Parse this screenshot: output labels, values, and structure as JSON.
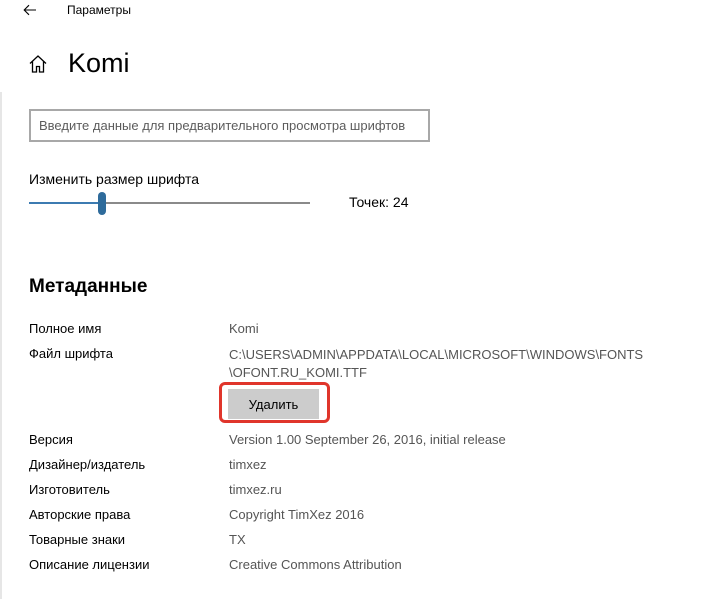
{
  "window": {
    "title": "Параметры",
    "back_icon": "back-arrow-icon"
  },
  "header": {
    "home_icon": "home-icon",
    "title": "Komi"
  },
  "preview": {
    "placeholder": "Введите данные для предварительного просмотра шрифтов",
    "value": ""
  },
  "font_size": {
    "label": "Изменить размер шрифта",
    "value_text": "Точек: 24",
    "slider_fraction": 0.26,
    "accent_color": "#2e6b9b"
  },
  "metadata": {
    "title": "Метаданные",
    "full_name_label": "Полное имя",
    "full_name_value": "Komi",
    "file_label": "Файл шрифта",
    "file_value_line1": "C:\\USERS\\ADMIN\\APPDATA\\LOCAL\\MICROSOFT\\WINDOWS\\FONTS",
    "file_value_line2": "\\OFONT.RU_KOMI.TTF",
    "delete_label": "Удалить",
    "highlight_color": "#e0352b",
    "rows": [
      {
        "label": "Версия",
        "value": "Version 1.00 September 26, 2016, initial release"
      },
      {
        "label": "Дизайнер/издатель",
        "value": "timxez"
      },
      {
        "label": "Изготовитель",
        "value": "timxez.ru"
      },
      {
        "label": "Авторские права",
        "value": "Copyright TimXez 2016"
      },
      {
        "label": "Товарные знаки",
        "value": "TX"
      },
      {
        "label": "Описание лицензии",
        "value": "Creative Commons Attribution"
      }
    ]
  }
}
